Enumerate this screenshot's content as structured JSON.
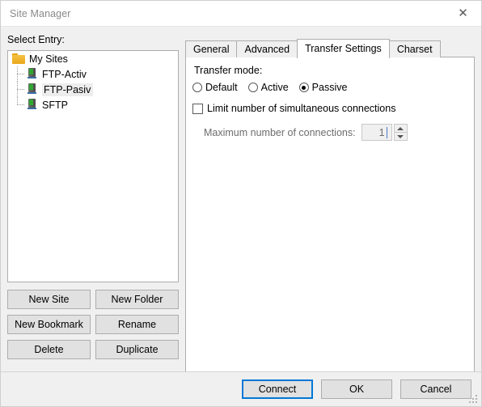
{
  "window": {
    "title": "Site Manager",
    "close_icon": "close-icon"
  },
  "left": {
    "select_entry_label": "Select Entry:",
    "tree": [
      {
        "label": "My Sites",
        "icon": "folder-icon",
        "level": 0,
        "selected": false
      },
      {
        "label": "FTP-Activ",
        "icon": "server-icon",
        "level": 1,
        "selected": false
      },
      {
        "label": "FTP-Pasiv",
        "icon": "server-icon",
        "level": 1,
        "selected": true
      },
      {
        "label": "SFTP",
        "icon": "server-icon",
        "level": 1,
        "selected": false
      }
    ],
    "buttons": [
      {
        "label": "New Site"
      },
      {
        "label": "New Folder"
      },
      {
        "label": "New Bookmark"
      },
      {
        "label": "Rename"
      },
      {
        "label": "Delete"
      },
      {
        "label": "Duplicate"
      }
    ]
  },
  "right": {
    "tabs": [
      {
        "label": "General",
        "active": false
      },
      {
        "label": "Advanced",
        "active": false
      },
      {
        "label": "Transfer Settings",
        "active": true
      },
      {
        "label": "Charset",
        "active": false
      }
    ],
    "transfer_mode": {
      "label": "Transfer mode:",
      "options": [
        {
          "label": "Default",
          "checked": false
        },
        {
          "label": "Active",
          "checked": false
        },
        {
          "label": "Passive",
          "checked": true
        }
      ]
    },
    "limit_connections": {
      "label": "Limit number of simultaneous connections",
      "checked": false
    },
    "max_connections": {
      "label": "Maximum number of connections:",
      "value": "1",
      "enabled": false,
      "spin_up_icon": "chevron-up-icon",
      "spin_down_icon": "chevron-down-icon"
    }
  },
  "footer": {
    "buttons": [
      {
        "label": "Connect",
        "default": true
      },
      {
        "label": "OK",
        "default": false
      },
      {
        "label": "Cancel",
        "default": false
      }
    ]
  },
  "colors": {
    "accent": "#0078d7",
    "window_bg": "#f0f0f0",
    "panel_bg": "#ffffff",
    "border": "#adadad",
    "folder_icon": "#e9a71b",
    "server_led": "#2fa82f"
  }
}
